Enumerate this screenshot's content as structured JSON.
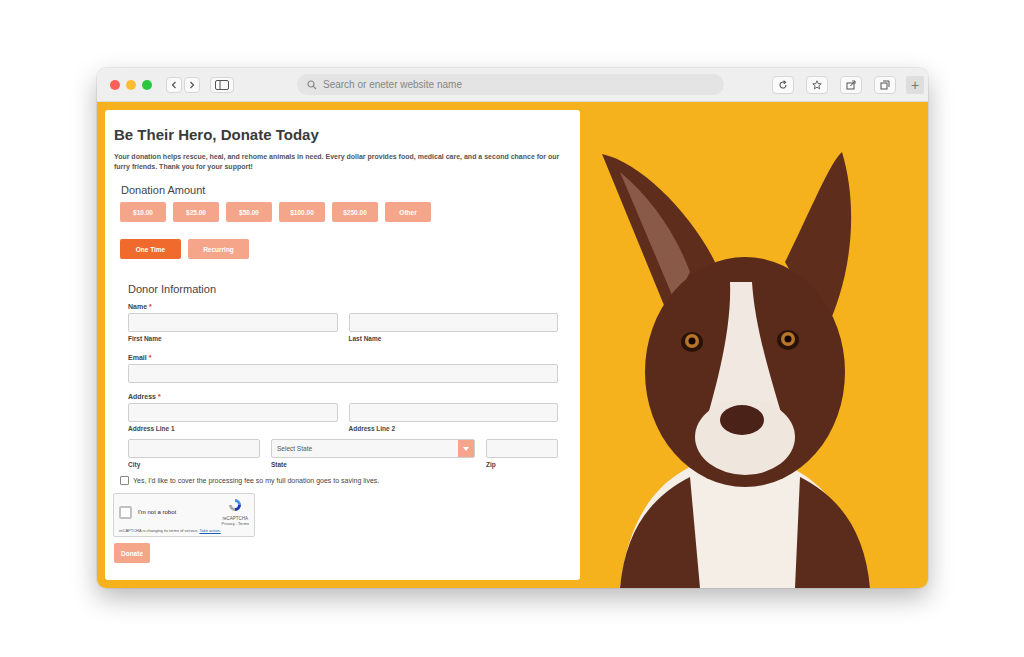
{
  "browser": {
    "search_placeholder": "Search or eneter website name",
    "new_tab": "+"
  },
  "form": {
    "title": "Be Their Hero, Donate Today",
    "description": "Your donation helps rescue, heal, and rehome animals in need. Every dollar provides food, medical care, and a second chance for our furry friends. Thank you for your support!",
    "amount_heading": "Donation Amount",
    "amounts": [
      {
        "label": "$10.00",
        "selected": false
      },
      {
        "label": "$25.00",
        "selected": false
      },
      {
        "label": "$50.00",
        "selected": false
      },
      {
        "label": "$100.00",
        "selected": false
      },
      {
        "label": "$250.00",
        "selected": false
      },
      {
        "label": "Other",
        "selected": false
      }
    ],
    "frequencies": [
      {
        "label": "One Time",
        "selected": true
      },
      {
        "label": "Recurring",
        "selected": false
      }
    ],
    "donor_heading": "Donor Information",
    "name": {
      "label": "Name",
      "required": "*",
      "first": "First Name",
      "last": "Last Name"
    },
    "email": {
      "label": "Email",
      "required": "*"
    },
    "address": {
      "label": "Address",
      "required": "*",
      "line1": "Address Line 1",
      "line2": "Address Line 2",
      "city": "City",
      "state": "State",
      "state_placeholder": "Select State",
      "zip": "Zip"
    },
    "cover_fee": {
      "label": "Yes, I'd like to cover the processing fee so my full donation goes to saving lives.",
      "checked": false
    },
    "captcha": {
      "label": "I'm not a robot",
      "checked": false,
      "brand": "reCAPTCHA",
      "links": "Privacy - Terms",
      "notice": "reCAPTCHA is changing its terms of service.",
      "notice_link": "Take action."
    },
    "submit": "Donate"
  }
}
